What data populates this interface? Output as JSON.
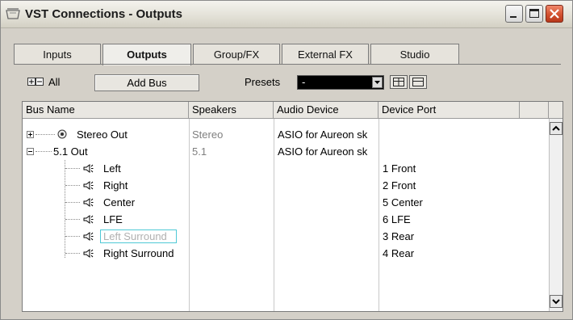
{
  "window": {
    "title": "VST Connections - Outputs"
  },
  "tabs": [
    {
      "label": "Inputs",
      "active": false
    },
    {
      "label": "Outputs",
      "active": true
    },
    {
      "label": "Group/FX",
      "active": false
    },
    {
      "label": "External FX",
      "active": false
    },
    {
      "label": "Studio",
      "active": false
    }
  ],
  "toolbar": {
    "all_label": "All",
    "add_bus_label": "Add Bus",
    "presets_label": "Presets",
    "presets_value": "-"
  },
  "table": {
    "headers": [
      "Bus Name",
      "Speakers",
      "Audio Device",
      "Device Port"
    ],
    "rows": [
      {
        "name": "Stereo Out",
        "speakers": "Stereo",
        "device": "ASIO for Aureon sk",
        "port": "",
        "level": 0,
        "expandable": "plus"
      },
      {
        "name": "5.1 Out",
        "speakers": "5.1",
        "device": "ASIO for Aureon sk",
        "port": "",
        "level": 0,
        "expandable": "minus"
      },
      {
        "name": "Left",
        "speakers": "",
        "device": "",
        "port": "1 Front",
        "level": 1
      },
      {
        "name": "Right",
        "speakers": "",
        "device": "",
        "port": "2 Front",
        "level": 1
      },
      {
        "name": "Center",
        "speakers": "",
        "device": "",
        "port": "5 Center",
        "level": 1
      },
      {
        "name": "LFE",
        "speakers": "",
        "device": "",
        "port": "6 LFE",
        "level": 1
      },
      {
        "name": "Left Surround",
        "speakers": "",
        "device": "",
        "port": "3 Rear",
        "level": 1,
        "selected": true
      },
      {
        "name": "Right Surround",
        "speakers": "",
        "device": "",
        "port": "4 Rear",
        "level": 1
      }
    ]
  },
  "colors": {
    "accent_selection": "#4fc9d6",
    "close_button": "#d2512f"
  },
  "icons": {
    "window": "speaker-window-icon",
    "bus_stereo": "globe-bus-icon",
    "channel": "speaker-icon",
    "scroll_up": "arrow-up-icon",
    "scroll_down": "arrow-down-icon"
  }
}
